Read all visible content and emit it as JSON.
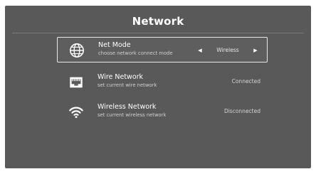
{
  "page": {
    "title": "Network"
  },
  "rows": [
    {
      "title": "Net Mode",
      "description": "choose network connect mode",
      "value": "Wireless",
      "icon": "globe-icon",
      "selected": true
    },
    {
      "title": "Wire Network",
      "description": "set current wire network",
      "value": "Connected",
      "icon": "ethernet-port-icon",
      "selected": false
    },
    {
      "title": "Wireless Network",
      "description": "set current wireless network",
      "value": "Disconnected",
      "icon": "wifi-icon",
      "selected": false
    }
  ],
  "selector": {
    "left_arrow": "◀",
    "right_arrow": "▶"
  },
  "colors": {
    "background": "#595959",
    "text": "#ffffff",
    "subtext": "#d0d0d0",
    "selected_border": "#e8e8e8"
  }
}
